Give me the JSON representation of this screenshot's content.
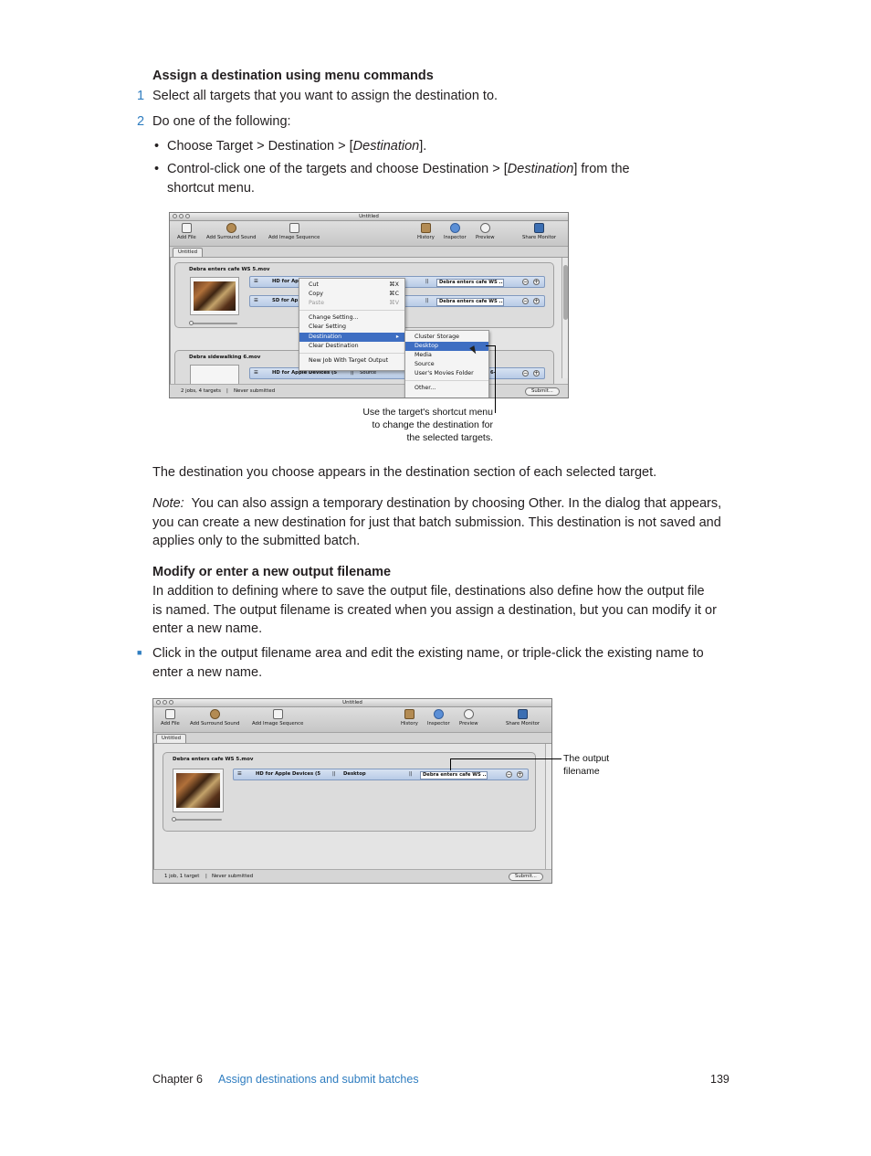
{
  "section1": {
    "heading": "Assign a destination using menu commands",
    "steps": [
      {
        "num": "1",
        "text": "Select all targets that you want to assign the destination to."
      },
      {
        "num": "2",
        "text": "Do one of the following:"
      }
    ],
    "bullets": [
      {
        "pre": "Choose Target > Destination > [",
        "em": "Destination",
        "post": "]."
      },
      {
        "pre": "Control-click one of the targets and choose Destination > [",
        "em": "Destination",
        "post": "] from the",
        "line2": "shortcut menu."
      }
    ],
    "bullet_char": "•"
  },
  "figure1": {
    "window_title": "Untitled",
    "toolbar": {
      "add_file": "Add File",
      "add_surround": "Add Surround Sound",
      "add_image_seq": "Add Image Sequence",
      "history": "History",
      "inspector": "Inspector",
      "preview": "Preview",
      "share_monitor": "Share Monitor"
    },
    "tab": "Untitled",
    "job1": {
      "source": "Debra enters cafe WS 5.mov",
      "target1_setting": "HD for Ap",
      "target1_output": "Debra enters cafe WS ...",
      "target2_setting": "SD for Ap",
      "target2_output": "Debra enters cafe WS ..."
    },
    "job2": {
      "source": "Debra sidewalking 6.mov",
      "target_setting": "HD for Apple Devices (5",
      "target_dest": "Source",
      "target_output": "6-"
    },
    "context_menu": {
      "cut": "Cut",
      "cut_sc": "⌘X",
      "copy": "Copy",
      "copy_sc": "⌘C",
      "paste": "Paste",
      "paste_sc": "⌘V",
      "change_setting": "Change Setting...",
      "clear_setting": "Clear Setting",
      "destination": "Destination",
      "clear_destination": "Clear Destination",
      "new_job": "New Job With Target Output"
    },
    "submenu": {
      "items": [
        "Cluster Storage",
        "Desktop",
        "Media",
        "Source",
        "User's Movies Folder"
      ],
      "other": "Other..."
    },
    "status": "2 jobs, 4 targets",
    "status_sep": "|",
    "submitted": "Never submitted",
    "submit_button": "Submit...",
    "callout_lines": [
      "Use the target's shortcut menu",
      "to change the destination for",
      "the selected targets."
    ]
  },
  "para1": "The destination you choose appears in the destination section of each selected target.",
  "note": {
    "label": "Note:",
    "line1": "You can also assign a temporary destination by choosing Other. In the dialog that appears,",
    "line2": "you can create a new destination for just that batch submission. This destination is not saved and",
    "line3": "applies only to the submitted batch."
  },
  "section2": {
    "heading": "Modify or enter a new output filename",
    "lines": [
      "In addition to defining where to save the output file, destinations also define how the output file",
      "is named. The output filename is created when you assign a destination, but you can modify it or",
      "enter a new name."
    ],
    "task_marker": "■",
    "task_lines": [
      "Click in the output filename area and edit the existing name, or triple-click the existing name to",
      "enter a new name."
    ]
  },
  "figure2": {
    "window_title": "Untitled",
    "tab": "Untitled",
    "source": "Debra enters cafe WS 5.mov",
    "target_setting": "HD for Apple Devices (5",
    "target_dest": "Desktop",
    "target_output": "Debra enters cafe WS ...",
    "status": "1 job, 1 target",
    "status_sep": "|",
    "submitted": "Never submitted",
    "submit_button": "Submit...",
    "callout_lines": [
      "The output",
      "filename"
    ]
  },
  "footer": {
    "chapter_label": "Chapter 6",
    "chapter_title": "Assign destinations and submit batches",
    "page": "139"
  }
}
